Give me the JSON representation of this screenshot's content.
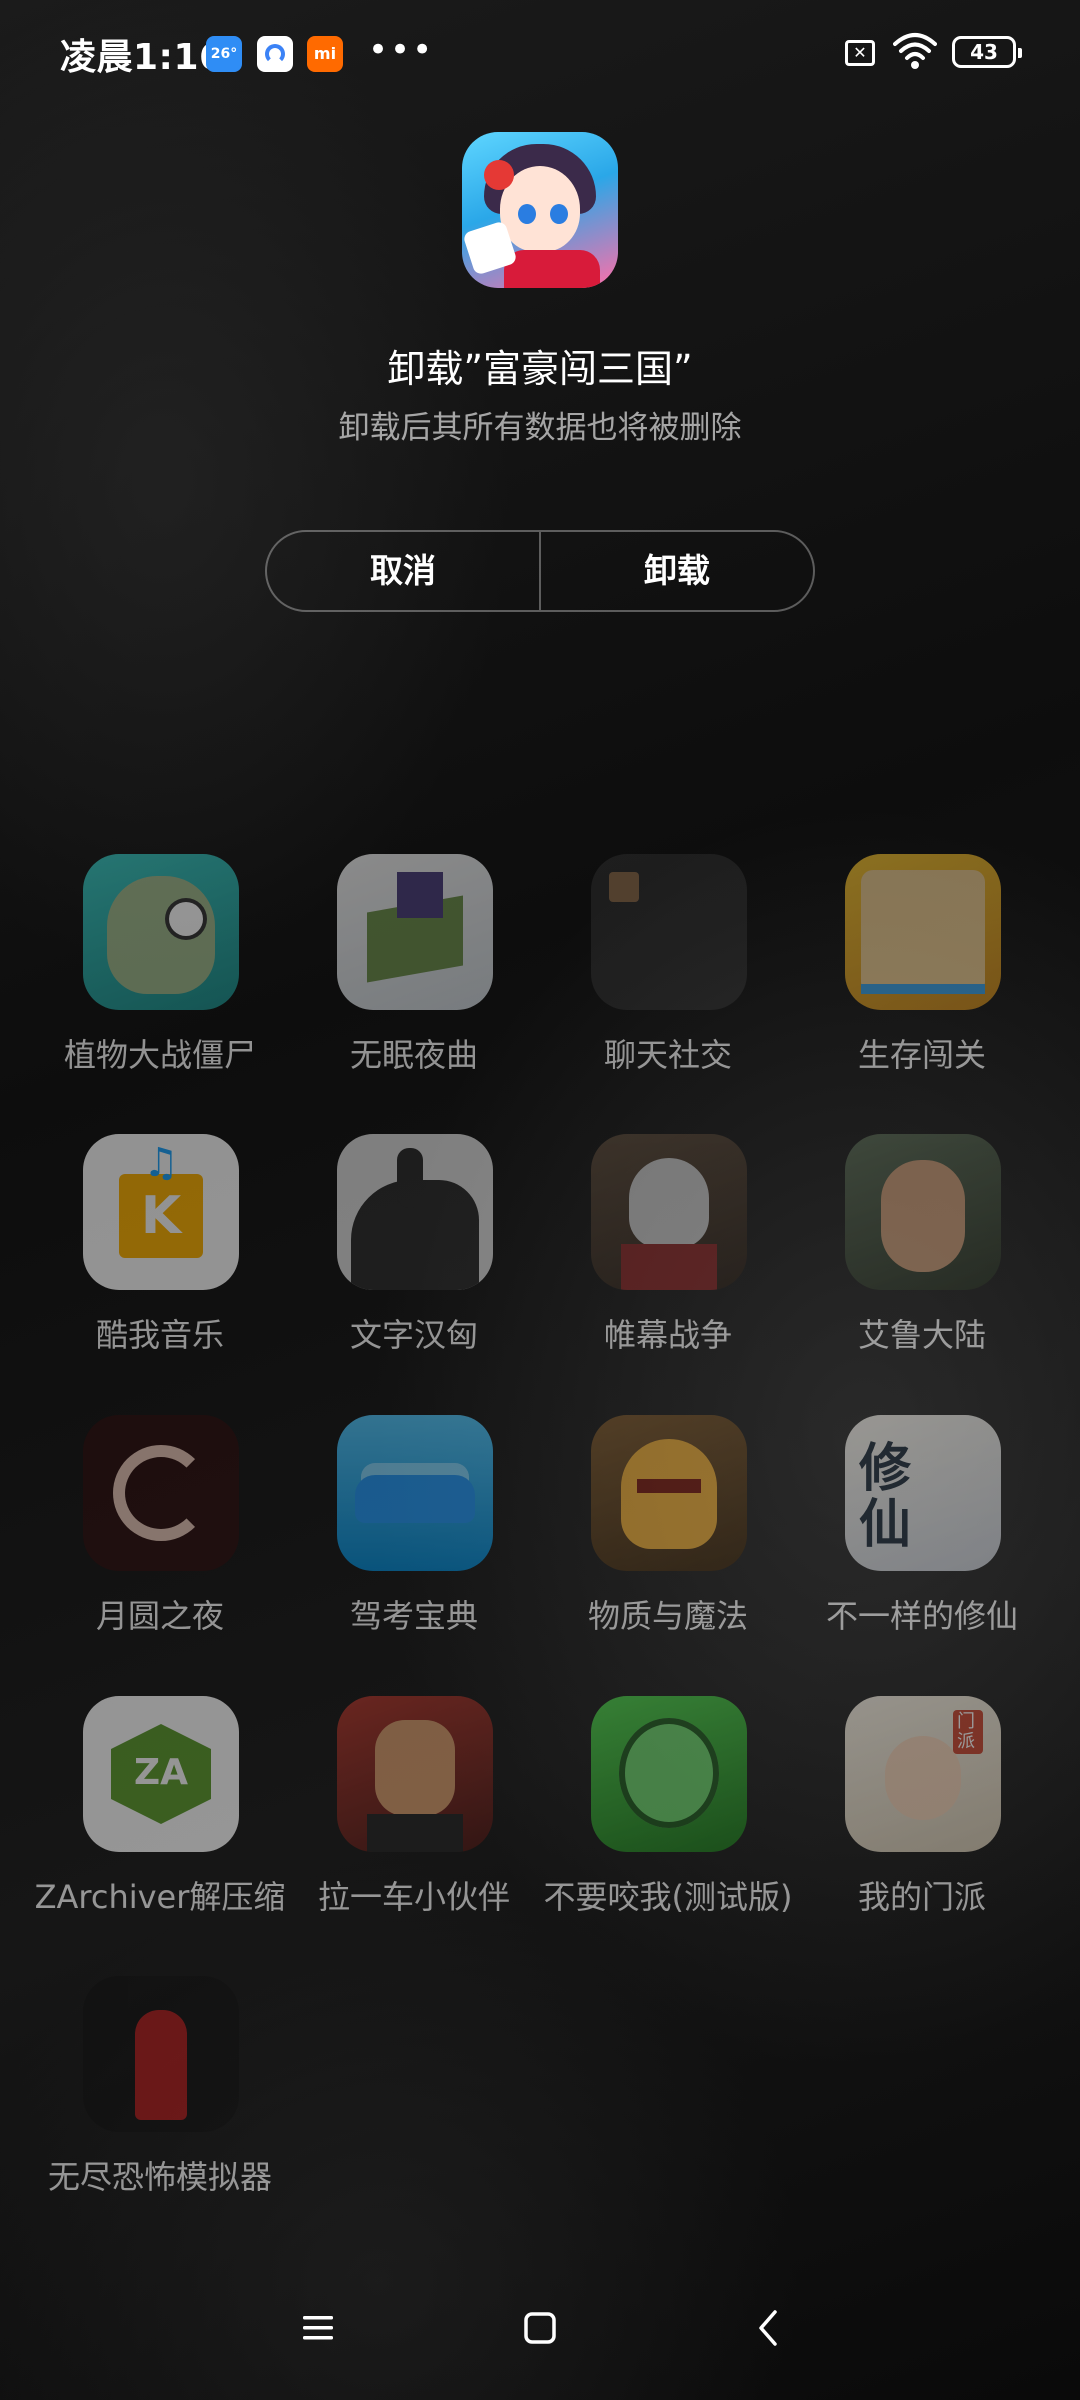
{
  "status_bar": {
    "time": "凌晨1:16",
    "weather_label": "26°",
    "mi_label": "mi",
    "more": "•••",
    "battery": "43"
  },
  "dialog": {
    "title": "卸载”富豪闯三国”",
    "subtitle": "卸载后其所有数据也将被删除",
    "cancel_label": "取消",
    "uninstall_label": "卸载"
  },
  "apps": [
    {
      "label": "植物大战僵尸",
      "icon": "pvz-zombie-icon"
    },
    {
      "label": "无眠夜曲",
      "icon": "night-castle-icon"
    },
    {
      "label": "聊天社交",
      "icon": "chat-folder-icon"
    },
    {
      "label": "生存闯关",
      "icon": "survival-puzzle-icon"
    },
    {
      "label": "酷我音乐",
      "icon": "kuwo-music-icon"
    },
    {
      "label": "文字汉匈",
      "icon": "horse-rider-icon"
    },
    {
      "label": "帷幕战争",
      "icon": "knight-icon"
    },
    {
      "label": "艾鲁大陆",
      "icon": "warrior-portrait-icon"
    },
    {
      "label": "月圆之夜",
      "icon": "full-moon-icon"
    },
    {
      "label": "驾考宝典",
      "icon": "car-icon"
    },
    {
      "label": "物质与魔法",
      "icon": "spartan-helmet-icon"
    },
    {
      "label": "不一样的修仙",
      "icon": "xiuxian-icon"
    },
    {
      "label": "ZArchiver解压缩",
      "icon": "zarchiver-icon"
    },
    {
      "label": "拉一车小伙伴",
      "icon": "angry-man-icon"
    },
    {
      "label": "不要咬我(测试版)",
      "icon": "green-zombie-icon"
    },
    {
      "label": "我的门派",
      "icon": "menpai-icon"
    },
    {
      "label": "无尽恐怖模拟器",
      "icon": "horror-girl-icon"
    }
  ],
  "colors": {
    "background": "#111111",
    "button_border": "#5a5a5a",
    "subtitle": "#9e9e9e"
  }
}
